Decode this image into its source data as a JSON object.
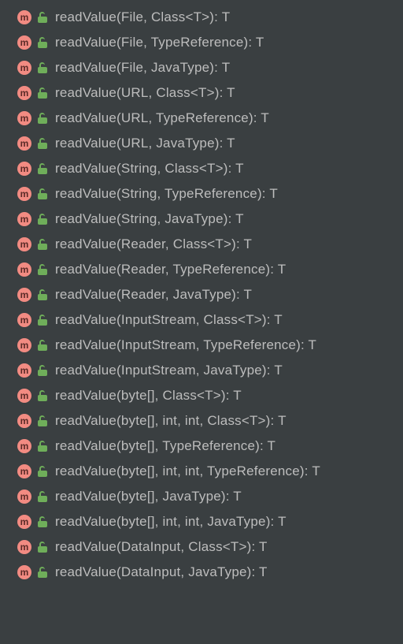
{
  "methodIconLetter": "m",
  "methods": [
    {
      "signature": "readValue(File, Class<T>): T"
    },
    {
      "signature": "readValue(File, TypeReference): T"
    },
    {
      "signature": "readValue(File, JavaType): T"
    },
    {
      "signature": "readValue(URL, Class<T>): T"
    },
    {
      "signature": "readValue(URL, TypeReference): T"
    },
    {
      "signature": "readValue(URL, JavaType): T"
    },
    {
      "signature": "readValue(String, Class<T>): T"
    },
    {
      "signature": "readValue(String, TypeReference): T"
    },
    {
      "signature": "readValue(String, JavaType): T"
    },
    {
      "signature": "readValue(Reader, Class<T>): T"
    },
    {
      "signature": "readValue(Reader, TypeReference): T"
    },
    {
      "signature": "readValue(Reader, JavaType): T"
    },
    {
      "signature": "readValue(InputStream, Class<T>): T"
    },
    {
      "signature": "readValue(InputStream, TypeReference): T"
    },
    {
      "signature": "readValue(InputStream, JavaType): T"
    },
    {
      "signature": "readValue(byte[], Class<T>): T"
    },
    {
      "signature": "readValue(byte[], int, int, Class<T>): T"
    },
    {
      "signature": "readValue(byte[], TypeReference): T"
    },
    {
      "signature": "readValue(byte[], int, int, TypeReference): T"
    },
    {
      "signature": "readValue(byte[], JavaType): T"
    },
    {
      "signature": "readValue(byte[], int, int, JavaType): T"
    },
    {
      "signature": "readValue(DataInput, Class<T>): T"
    },
    {
      "signature": "readValue(DataInput, JavaType): T"
    }
  ]
}
